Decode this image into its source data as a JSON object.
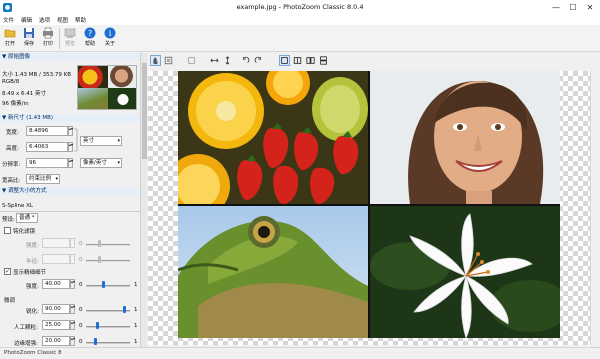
{
  "window": {
    "title": "example.jpg - PhotoZoom Classic 8.0.4",
    "minimize": "—",
    "maximize": "☐",
    "close": "✕"
  },
  "menu": [
    "文件",
    "编辑",
    "选项",
    "视图",
    "帮助"
  ],
  "toolbar": {
    "open": "打开",
    "save": "保存",
    "print": "打印",
    "preview": "预览",
    "help": "帮助",
    "about": "关于"
  },
  "original_image": {
    "header": "原始图像",
    "size": "大小 1.43 MB / 353.79 KB",
    "mode": "RGB/8",
    "dimensions": "8.49 x 6.41 英寸",
    "resolution": "96 像素/in"
  },
  "new_size": {
    "header": "新尺寸 (1.43 MB)",
    "width_label": "宽度:",
    "width_value": "8.4896",
    "height_label": "高度:",
    "height_value": "6.4063",
    "unit": "英寸",
    "resolution_label": "分辨率:",
    "resolution_value": "96",
    "resolution_unit": "像素/英寸",
    "aspect_label": "宽高比:",
    "aspect_value": "约束比例"
  },
  "resize_method": {
    "header": "调整大小的方式",
    "method": "S-Spline XL",
    "preset_label": "预设:",
    "preset_value": "普通 *"
  },
  "settings": {
    "reduce_artifacts_label": "钝化滤镜",
    "strength_label": "强度:",
    "radius_label": "半径:",
    "show_details_label": "显示精细细节",
    "detail_strength_label": "强度:",
    "detail_strength_value": "40.00",
    "fine_tune_label": "微调",
    "sharpen_label": "锐化:",
    "sharpen_value": "90.00",
    "film_grain_label": "人工颗粒:",
    "film_grain_value": "25.00",
    "edge_label": "边缘增强:",
    "edge_value": "20.00",
    "slider_min": "0",
    "slider_max": "1"
  },
  "levels": {
    "detail_strength": 0.4,
    "sharpen": 0.9,
    "film_grain": 0.25,
    "edge": 0.2
  },
  "statusbar": {
    "text": "PhotoZoom Classic 8"
  },
  "colors": {
    "accent": "#1e6fd9",
    "section_bg": "#e6eef8",
    "window_bg": "#f0f0f0"
  }
}
